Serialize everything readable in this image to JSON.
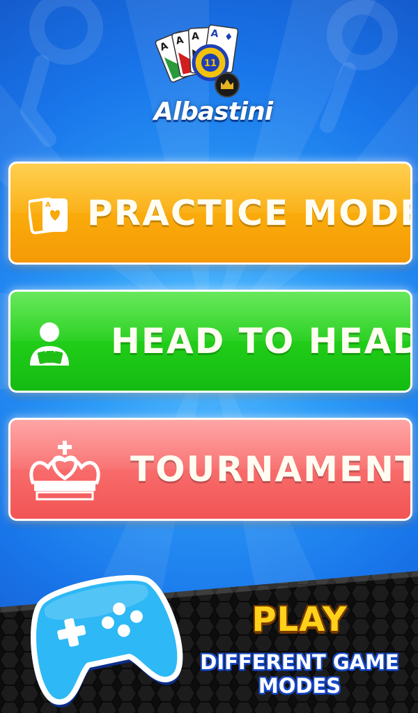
{
  "app": {
    "logo_text": "Albastini",
    "logo_card_rank": "A",
    "logo_chip_number": "11"
  },
  "modes": [
    {
      "label": "PRACTICE MODE",
      "icon": "cards-icon",
      "color": "#f9aa0c"
    },
    {
      "label": "HEAD TO HEAD",
      "icon": "player-cards-icon",
      "color": "#22cc18"
    },
    {
      "label": "TOURNAMENT",
      "icon": "crown-icon",
      "color": "#f76a6a"
    }
  ],
  "promo": {
    "headline": "PLAY",
    "subline_1": "DIFFERENT GAME",
    "subline_2": "MODES",
    "icon": "gamepad-icon"
  },
  "colors": {
    "background": "#1f7df0",
    "promo_headline": "#ffd11a",
    "controller": "#2eb8f5"
  }
}
